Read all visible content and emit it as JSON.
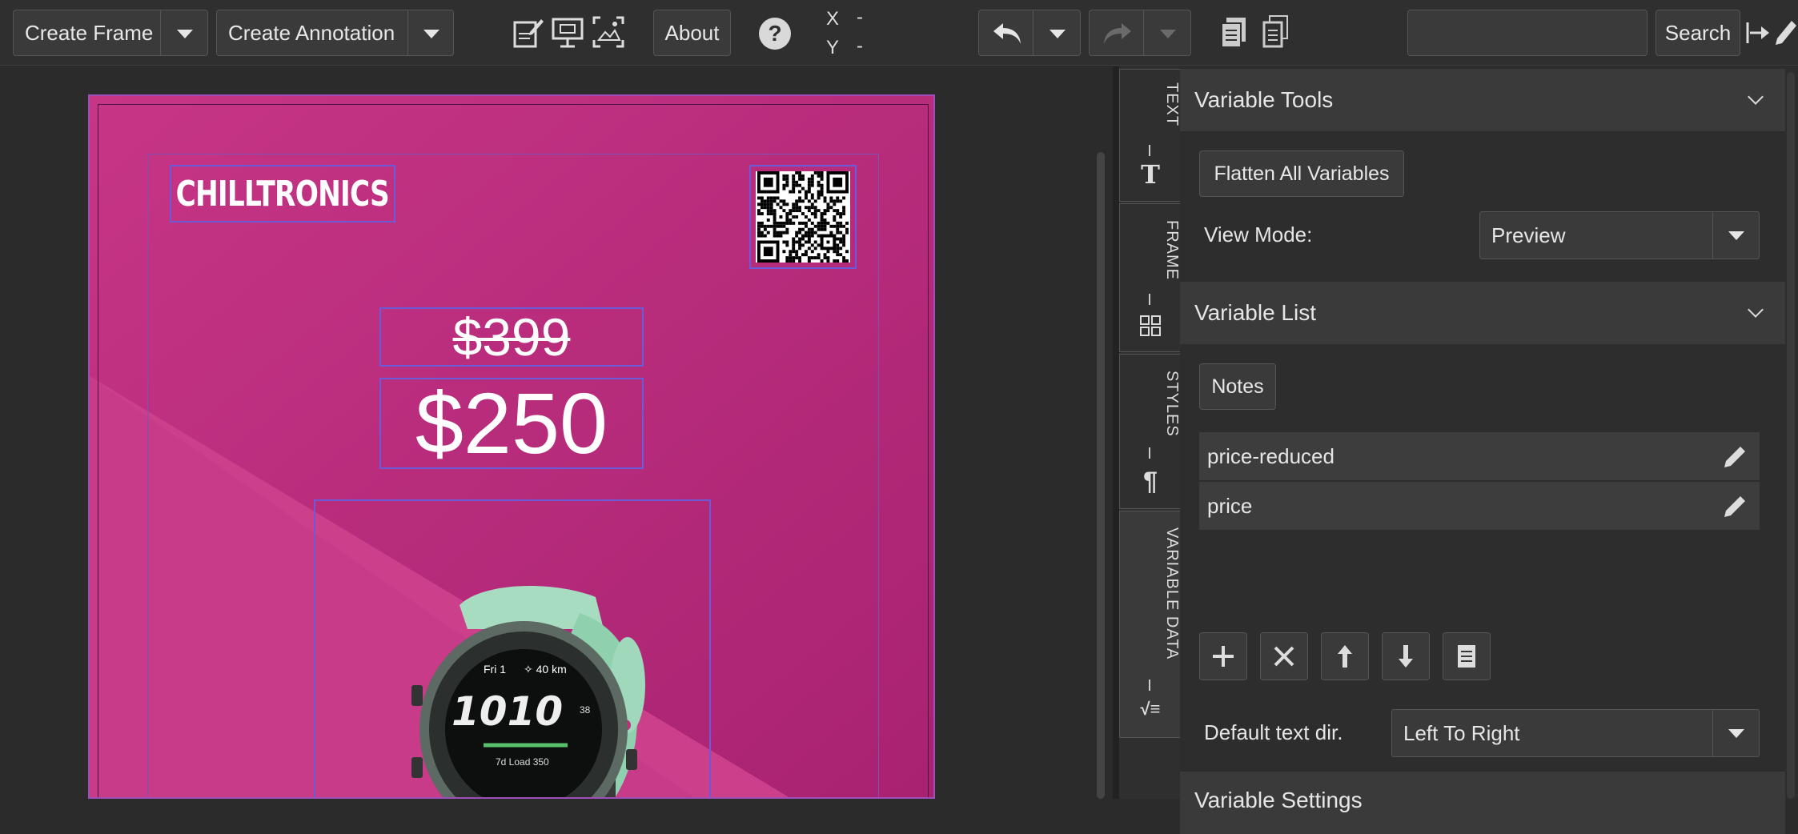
{
  "toolbar": {
    "create_frame": "Create Frame",
    "create_annotation": "Create Annotation",
    "about": "About",
    "help": "?",
    "x_label": "X",
    "x_value": "-",
    "y_label": "Y",
    "y_value": "-",
    "search_placeholder": "",
    "search_button": "Search",
    "icons": [
      "edit-document-icon",
      "presentation-icon",
      "image-placeholder-icon",
      "undo-icon",
      "redo-icon",
      "copy-icon",
      "paste-icon",
      "exit-icon",
      "pencil-icon"
    ]
  },
  "canvas": {
    "brand": "CHILLTRONICS",
    "old_price": "$399",
    "price": "$250",
    "watch": {
      "date": "Fri 1",
      "distance": "40 km",
      "time_h": "10",
      "time_m": "10",
      "seconds": "38",
      "load": "7d Load 350"
    }
  },
  "tabs": [
    {
      "label": "TEXT",
      "icon": "T"
    },
    {
      "label": "FRAME",
      "icon": "grid"
    },
    {
      "label": "STYLES",
      "icon": "¶"
    },
    {
      "label": "VARIABLE DATA",
      "icon": "√≡"
    }
  ],
  "variable_tools": {
    "title": "Variable Tools",
    "flatten_button": "Flatten All Variables",
    "view_mode_label": "View Mode:",
    "view_mode_value": "Preview"
  },
  "variable_list": {
    "title": "Variable List",
    "notes_button": "Notes",
    "items": [
      "price-reduced",
      "price"
    ],
    "default_dir_label": "Default text dir.",
    "default_dir_value": "Left To Right"
  },
  "variable_settings": {
    "title": "Variable Settings"
  },
  "colors": {
    "poster": "#c2307f",
    "accent": "#6a5bd8"
  }
}
